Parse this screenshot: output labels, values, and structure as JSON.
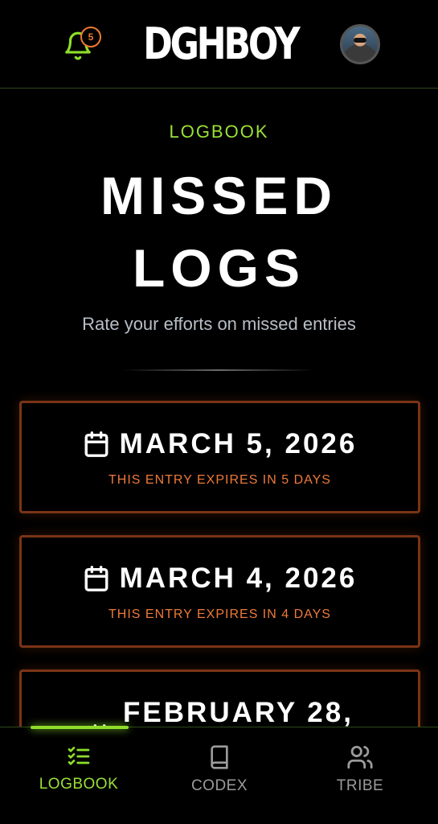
{
  "header": {
    "logo": "DGHBOY",
    "notification_count": "5",
    "bell_icon": "bell-icon",
    "avatar_icon": "user-avatar"
  },
  "hero": {
    "eyebrow": "LOGBOOK",
    "title_line1": "MISSED",
    "title_line2": "LOGS",
    "subtitle": "Rate your efforts on missed entries"
  },
  "entries": [
    {
      "date": "MARCH 5, 2026",
      "expiry": "THIS ENTRY EXPIRES IN 5 DAYS"
    },
    {
      "date": "MARCH 4, 2026",
      "expiry": "THIS ENTRY EXPIRES IN 4 DAYS"
    },
    {
      "date": "FEBRUARY 28,",
      "expiry": ""
    }
  ],
  "nav": {
    "items": [
      {
        "label": "LOGBOOK",
        "icon": "checklist-icon",
        "active": true
      },
      {
        "label": "CODEX",
        "icon": "book-icon",
        "active": false
      },
      {
        "label": "TRIBE",
        "icon": "users-icon",
        "active": false
      }
    ]
  },
  "colors": {
    "accent": "#9ae036",
    "warning": "#ee7a3a",
    "card_border": "#7a3416",
    "background": "#000000"
  }
}
